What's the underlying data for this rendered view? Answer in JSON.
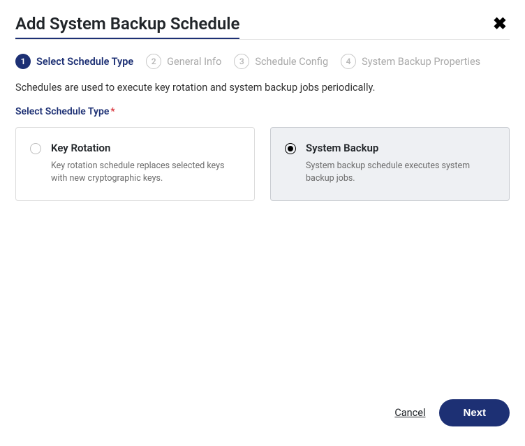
{
  "dialog": {
    "title": "Add System Backup Schedule"
  },
  "steps": [
    {
      "num": "1",
      "label": "Select Schedule Type",
      "state": "active"
    },
    {
      "num": "2",
      "label": "General Info",
      "state": "inactive"
    },
    {
      "num": "3",
      "label": "Schedule Config",
      "state": "inactive"
    },
    {
      "num": "4",
      "label": "System Backup Properties",
      "state": "inactive"
    }
  ],
  "description": "Schedules are used to execute key rotation and system backup jobs periodically.",
  "field": {
    "label": "Select Schedule Type",
    "required": "*"
  },
  "options": [
    {
      "id": "key-rotation",
      "title": "Key Rotation",
      "desc": "Key rotation schedule replaces selected keys with new cryptographic keys.",
      "selected": false
    },
    {
      "id": "system-backup",
      "title": "System Backup",
      "desc": "System backup schedule executes system backup jobs.",
      "selected": true
    }
  ],
  "footer": {
    "cancel": "Cancel",
    "next": "Next"
  }
}
